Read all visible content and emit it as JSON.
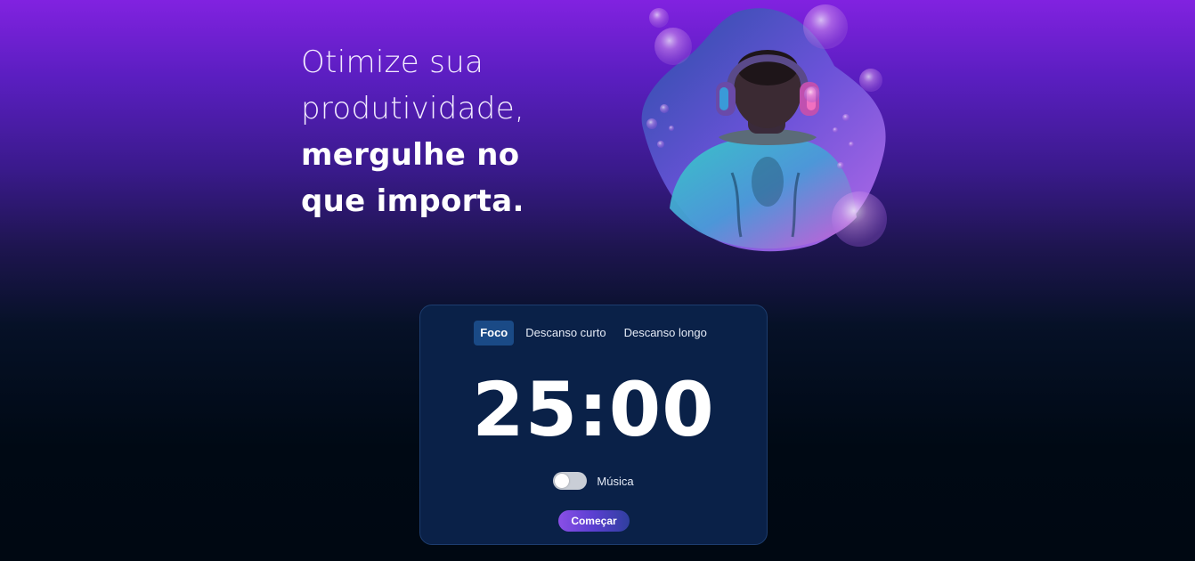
{
  "hero": {
    "line1": "Otimize sua",
    "line2": "produtividade,",
    "line3": "mergulhe no",
    "line4": "que importa."
  },
  "timer": {
    "tabs": [
      {
        "label": "Foco",
        "active": true
      },
      {
        "label": "Descanso curto",
        "active": false
      },
      {
        "label": "Descanso longo",
        "active": false
      }
    ],
    "time": "25:00",
    "music_label": "Música",
    "music_on": false,
    "start_label": "Começar"
  },
  "colors": {
    "background_top": "#8122e0",
    "background_bottom": "#000812",
    "card": "#0a2148",
    "active_tab": "#1a4a86",
    "button_start": "#8a4fe6",
    "button_end": "#2f3f9e"
  },
  "image": {
    "subject": "person-with-headphones-and-bubbles-illustration"
  }
}
